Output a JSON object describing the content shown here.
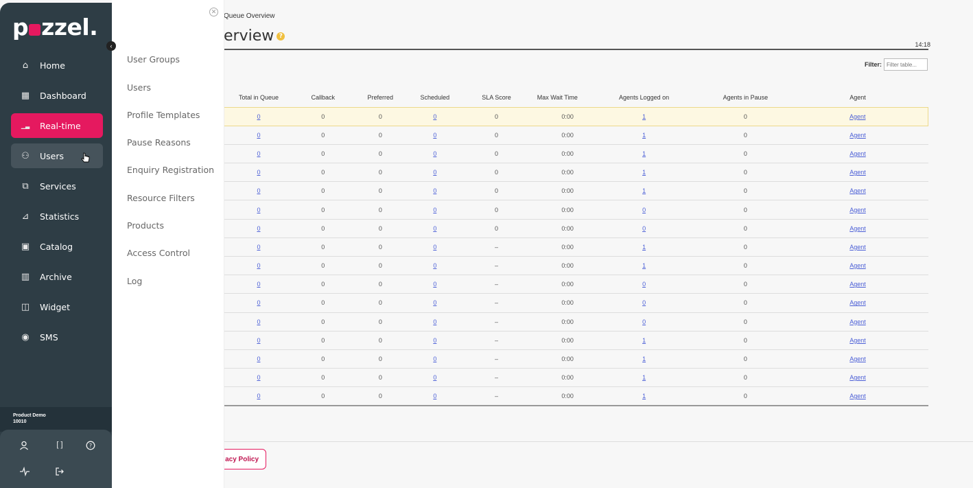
{
  "sidebar": {
    "logo": "pzzel.",
    "logo_left": "p",
    "logo_right": "zzel.",
    "items": [
      {
        "label": "Home",
        "icon": "home-icon"
      },
      {
        "label": "Dashboard",
        "icon": "dashboard-icon"
      },
      {
        "label": "Real-time",
        "icon": "chart-icon",
        "active": true
      },
      {
        "label": "Users",
        "icon": "users-icon",
        "hover": true
      },
      {
        "label": "Services",
        "icon": "services-icon"
      },
      {
        "label": "Statistics",
        "icon": "statistics-icon"
      },
      {
        "label": "Catalog",
        "icon": "catalog-icon"
      },
      {
        "label": "Archive",
        "icon": "archive-icon"
      },
      {
        "label": "Widget",
        "icon": "widget-icon"
      },
      {
        "label": "SMS",
        "icon": "sms-icon"
      }
    ],
    "account_name": "Product Demo",
    "account_id": "10010"
  },
  "submenu": {
    "items": [
      "User Groups",
      "Users",
      "Profile Templates",
      "Pause Reasons",
      "Enquiry Registration",
      "Resource Filters",
      "Products",
      "Access Control",
      "Log"
    ]
  },
  "main": {
    "breadcrumb": "Queue Overview",
    "title": "erview",
    "clock": "14:18",
    "filter_label": "Filter:",
    "filter_placeholder": "Filter table...",
    "privacy_label": "acy Policy"
  },
  "table": {
    "headers": [
      "Total in Queue",
      "Callback",
      "Preferred",
      "Scheduled",
      "SLA Score",
      "Max Wait Time",
      "Agents Logged on",
      "Agents in Pause",
      "Agent"
    ],
    "rows": [
      [
        "0",
        "0",
        "0",
        "0",
        "0",
        "0:00",
        "1",
        "0",
        "Agent"
      ],
      [
        "0",
        "0",
        "0",
        "0",
        "0",
        "0:00",
        "1",
        "0",
        "Agent"
      ],
      [
        "0",
        "0",
        "0",
        "0",
        "0",
        "0:00",
        "1",
        "0",
        "Agent"
      ],
      [
        "0",
        "0",
        "0",
        "0",
        "0",
        "0:00",
        "1",
        "0",
        "Agent"
      ],
      [
        "0",
        "0",
        "0",
        "0",
        "0",
        "0:00",
        "1",
        "0",
        "Agent"
      ],
      [
        "0",
        "0",
        "0",
        "0",
        "0",
        "0:00",
        "0",
        "0",
        "Agent"
      ],
      [
        "0",
        "0",
        "0",
        "0",
        "0",
        "0:00",
        "0",
        "0",
        "Agent"
      ],
      [
        "0",
        "0",
        "0",
        "0",
        "–",
        "0:00",
        "1",
        "0",
        "Agent"
      ],
      [
        "0",
        "0",
        "0",
        "0",
        "–",
        "0:00",
        "1",
        "0",
        "Agent"
      ],
      [
        "0",
        "0",
        "0",
        "0",
        "–",
        "0:00",
        "0",
        "0",
        "Agent"
      ],
      [
        "0",
        "0",
        "0",
        "0",
        "–",
        "0:00",
        "0",
        "0",
        "Agent"
      ],
      [
        "0",
        "0",
        "0",
        "0",
        "–",
        "0:00",
        "0",
        "0",
        "Agent"
      ],
      [
        "0",
        "0",
        "0",
        "0",
        "–",
        "0:00",
        "1",
        "0",
        "Agent"
      ],
      [
        "0",
        "0",
        "0",
        "0",
        "–",
        "0:00",
        "1",
        "0",
        "Agent"
      ],
      [
        "0",
        "0",
        "0",
        "0",
        "–",
        "0:00",
        "1",
        "0",
        "Agent"
      ],
      [
        "0",
        "0",
        "0",
        "0",
        "–",
        "0:00",
        "1",
        "0",
        "Agent"
      ]
    ]
  },
  "colors": {
    "brand": "#e5195f",
    "sidebar_bg": "#2e3d45",
    "link": "#4a5ed6",
    "highlight_row": "#fdf8e2"
  }
}
